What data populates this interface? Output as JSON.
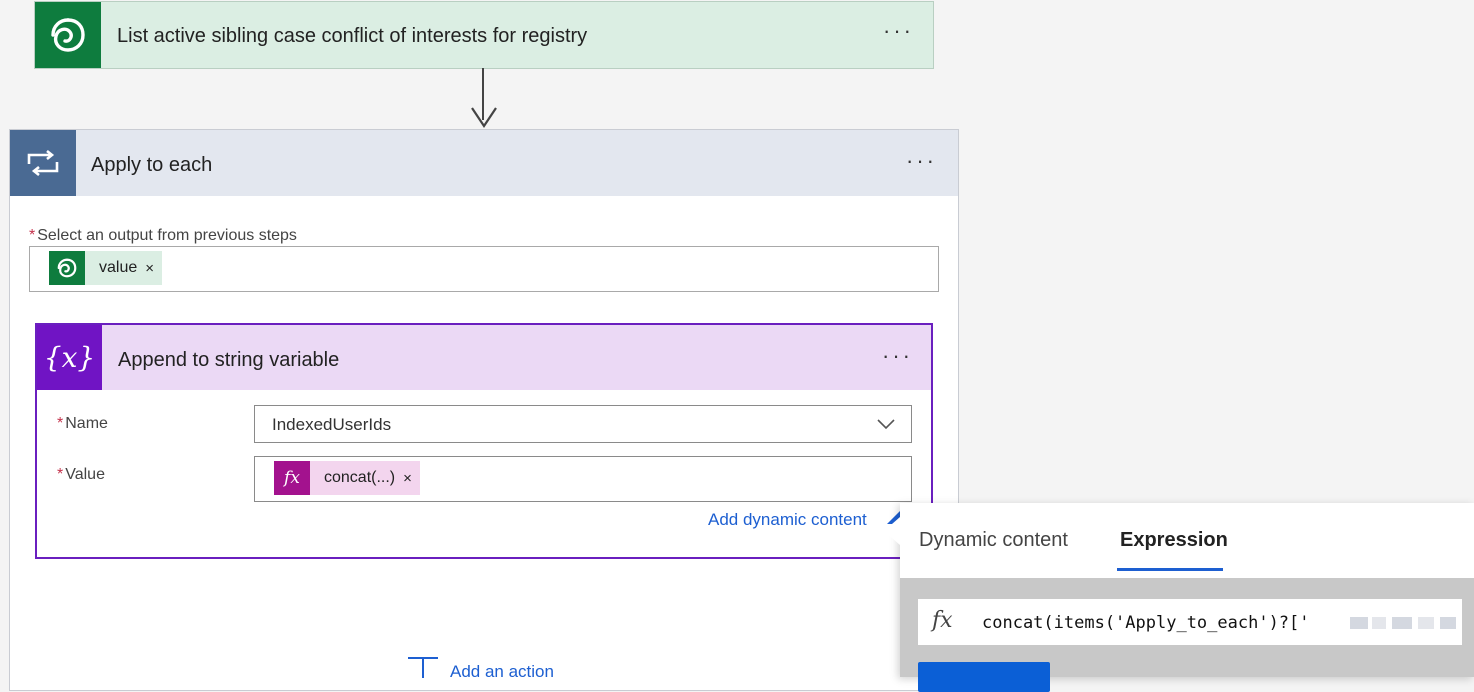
{
  "list_step": {
    "title": "List active sibling case conflict of interests for registry",
    "more": "···",
    "icon": "dataverse-icon"
  },
  "apply_to_each": {
    "title": "Apply to each",
    "more": "···",
    "icon": "loop-icon",
    "output_label": "Select an output from previous steps",
    "required_mark": "*",
    "output_token": {
      "label": "value",
      "remove": "×",
      "icon": "dataverse-icon"
    }
  },
  "append_step": {
    "title": "Append to string variable",
    "icon_text": "{x}",
    "more": "···",
    "name_label": "Name",
    "name_value": "IndexedUserIds",
    "value_label": "Value",
    "value_token": {
      "icon_text": "fx",
      "label": "concat(...)",
      "remove": "×"
    },
    "add_dynamic_link": "Add dynamic content"
  },
  "popover": {
    "tabs": [
      {
        "label": "Dynamic content",
        "active": false
      },
      {
        "label": "Expression",
        "active": true
      }
    ],
    "expression_icon_text": "fx",
    "expression_text": "concat(items('Apply_to_each')?['"
  },
  "add_action_label": "Add an action",
  "colors": {
    "dataverse_green": "#0e7c3e",
    "loop_blue": "#4a6a93",
    "variable_purple": "#7014c4",
    "expression_magenta": "#a3128e",
    "link_blue": "#1d5fd1"
  }
}
